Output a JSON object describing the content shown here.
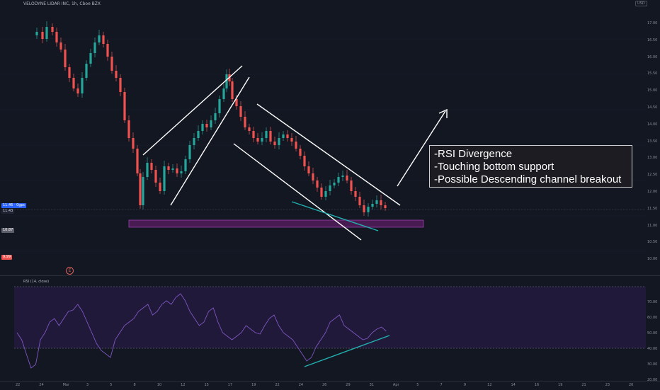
{
  "header": {
    "symbol_line": "VELODYNE LIDAR INC, 1h, Cboe BZX",
    "badge": "USD"
  },
  "price_axis": {
    "labels": [
      "17.00",
      "16.50",
      "16.00",
      "15.50",
      "15.00",
      "14.50",
      "14.00",
      "13.50",
      "13.00",
      "12.50",
      "12.00",
      "11.50",
      "11.00",
      "10.50",
      "10.00"
    ]
  },
  "price_tags": {
    "current_left": "11.46 · 0gpc",
    "current_left2": "11.43",
    "support": "10.87",
    "low": "9.99"
  },
  "rsi": {
    "title": "RSI (14, close)",
    "axis_labels": [
      "70.00",
      "60.00",
      "50.00",
      "40.00",
      "30.00",
      "20.00"
    ]
  },
  "time_axis": {
    "labels": [
      "22",
      "24",
      "Mar",
      "3",
      "5",
      "8",
      "10",
      "12",
      "15",
      "17",
      "19",
      "22",
      "24",
      "26",
      "29",
      "31",
      "Apr",
      "5",
      "7",
      "9",
      "12",
      "14",
      "16",
      "19",
      "21",
      "23",
      "26"
    ]
  },
  "annotation": {
    "line1": "-RSI Divergence",
    "line2": "-Touching bottom support",
    "line3": "-Possible Descending channel breakout"
  },
  "colors": {
    "background": "#131722",
    "up_candle": "#26a69a",
    "down_candle": "#ef5350",
    "support_zone": "#5b1f63",
    "rsi_line": "#7e57c2",
    "rsi_band": "#21193a",
    "trendline_teal": "#22b0b0",
    "channel_lines": "#ffffff"
  },
  "icons": {
    "logo_button": "E"
  }
}
